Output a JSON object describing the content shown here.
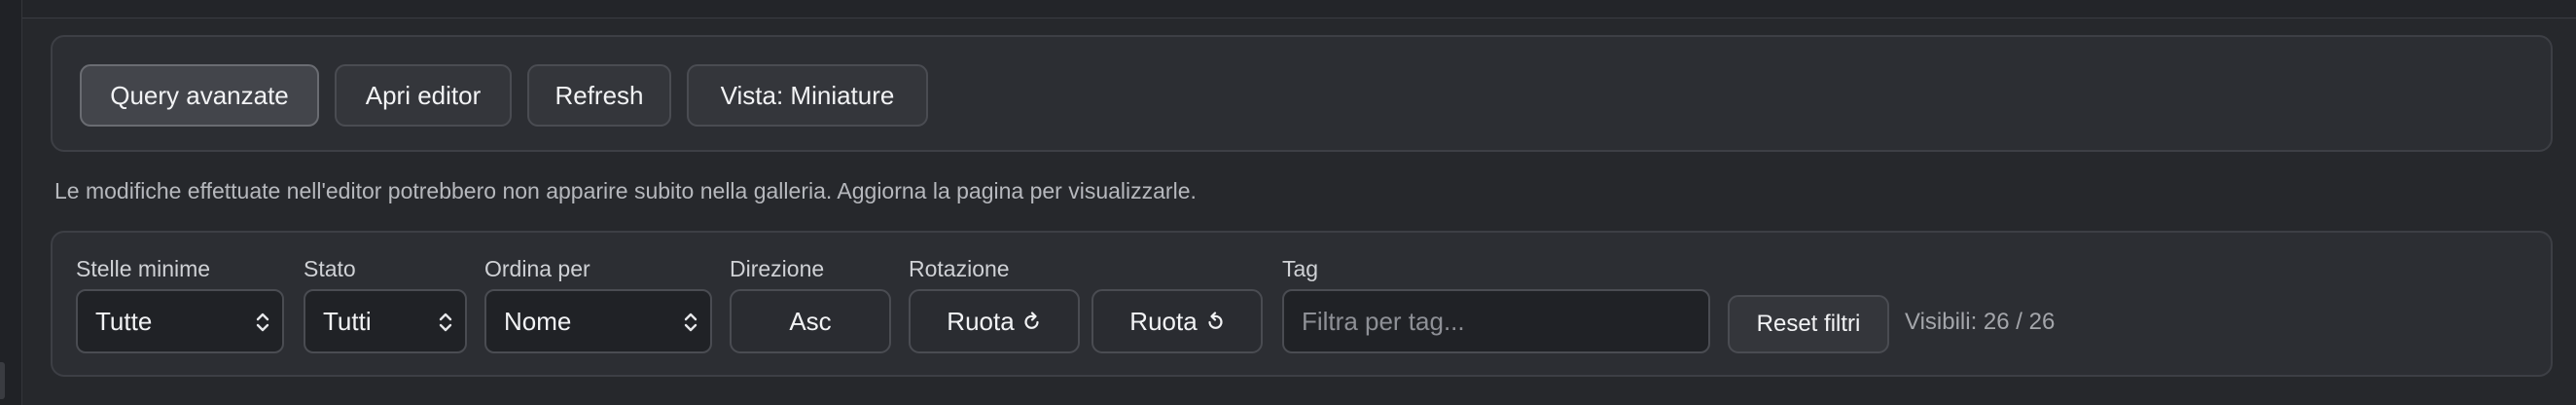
{
  "toolbar": {
    "query_label": "Query avanzate",
    "editor_label": "Apri editor",
    "refresh_label": "Refresh",
    "view_label": "Vista: Miniature"
  },
  "notice": "Le modifiche effettuate nell'editor potrebbero non apparire subito nella galleria. Aggiorna la pagina per visualizzarle.",
  "filters": {
    "stars": {
      "label": "Stelle minime",
      "value": "Tutte"
    },
    "state": {
      "label": "Stato",
      "value": "Tutti"
    },
    "sort": {
      "label": "Ordina per",
      "value": "Nome"
    },
    "direction": {
      "label": "Direzione",
      "value": "Asc"
    },
    "rotation": {
      "label": "Rotazione",
      "cw_label": "Ruota",
      "ccw_label": "Ruota"
    },
    "tag": {
      "label": "Tag",
      "placeholder": "Filtra per tag..."
    },
    "reset_label": "Reset filtri",
    "visible_count": "Visibili: 26 / 26"
  },
  "icons": {
    "select_caret": "chevron-up-down-icon",
    "rotate_cw": "rotate-clockwise-icon",
    "rotate_ccw": "rotate-counterclockwise-icon"
  }
}
